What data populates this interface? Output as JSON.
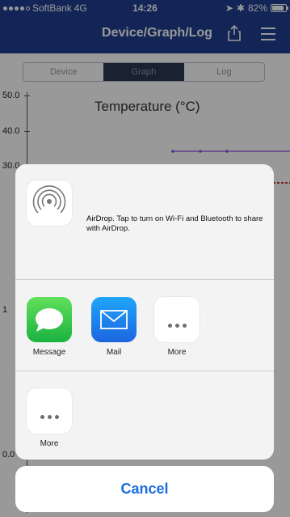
{
  "status": {
    "carrier": "SoftBank",
    "network": "4G",
    "time": "14:26",
    "battery": "82%"
  },
  "navbar": {
    "title": "Device/Graph/Log"
  },
  "segments": [
    "Device",
    "Graph",
    "Log"
  ],
  "chart": {
    "title": "Temperature (°C)",
    "y_ticks": [
      "50.0",
      "40.0",
      "30.0",
      "1",
      "0.0"
    ]
  },
  "share_sheet": {
    "airdrop": {
      "title": "AirDrop.",
      "text": "Tap to turn on Wi-Fi and Bluetooth to share with AirDrop."
    },
    "apps": [
      {
        "label": "Message",
        "icon": "message-icon"
      },
      {
        "label": "Mail",
        "icon": "mail-icon"
      },
      {
        "label": "More",
        "icon": "more-icon"
      }
    ],
    "actions": [
      {
        "label": "More",
        "icon": "more-icon"
      }
    ],
    "cancel_label": "Cancel"
  },
  "colors": {
    "navbar": "#1f3f8f",
    "accent": "#1a6ce0"
  }
}
